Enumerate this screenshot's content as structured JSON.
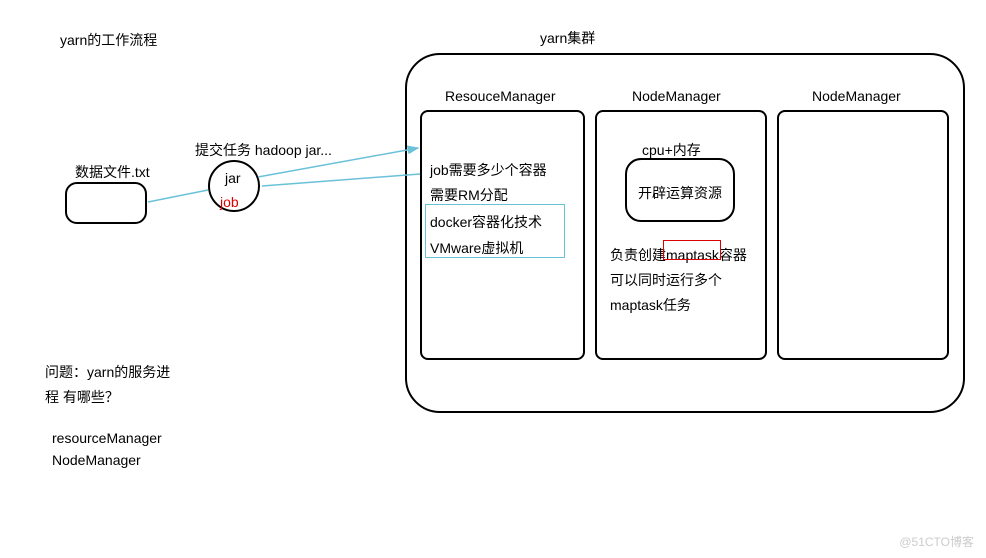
{
  "title_left": "yarn的工作流程",
  "cluster_title": "yarn集群",
  "rm_title": "ResouceManager",
  "nm1_title": "NodeManager",
  "nm2_title": "NodeManager",
  "rm": {
    "line1": "job需要多少个容器",
    "line2": "需要RM分配",
    "line3": "docker容器化技术",
    "line4": "VMware虚拟机"
  },
  "nm1": {
    "cpu_label": "cpu+内存",
    "cpu_inner": "开辟运算资源",
    "line1": "负责创建maptask容器",
    "line2": "可以同时运行多个",
    "line3": "maptask任务"
  },
  "submit_label": "提交任务 hadoop jar...",
  "jar_label": "jar",
  "job_label": "job",
  "data_file_label": "数据文件.txt",
  "question": "问题：yarn的服务进程 有哪些？",
  "answer1": "resourceManager",
  "answer2": "NodeManager",
  "watermark": "@51CTO博客"
}
